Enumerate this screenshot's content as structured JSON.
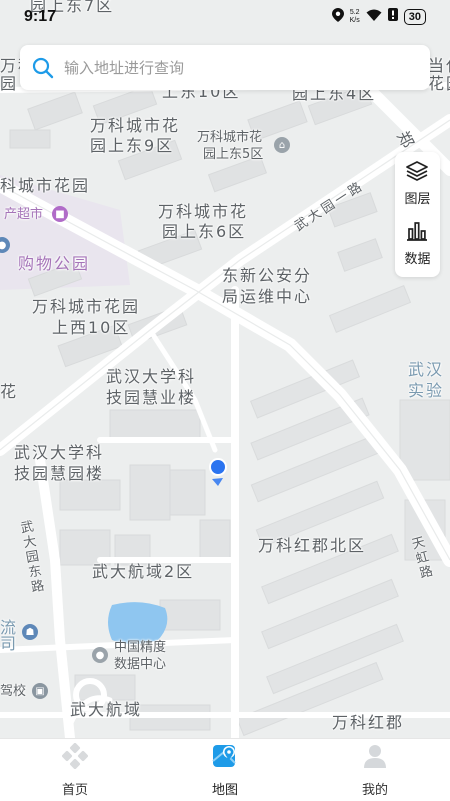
{
  "status_bar": {
    "time": "9:17",
    "net_speed_value": "5.2",
    "net_speed_unit": "K/s",
    "battery": "30"
  },
  "search": {
    "placeholder": "输入地址进行查询",
    "icon": "search-icon"
  },
  "side_panel": {
    "layers_label": "图层",
    "data_label": "数据"
  },
  "map": {
    "labels": {
      "top_cut": "园上东7区",
      "wanke_left_top": "万科",
      "wanke_left_top2": "园",
      "dangdai_right": "当代",
      "dangdai_right2": "花园",
      "shang10": "上东10区",
      "shangdong4": "园上东4区",
      "garden9_l1": "万科城市花",
      "garden9_l2": "园上东9区",
      "garden5_l1": "万科城市花",
      "garden5_l2": "园上东5区",
      "zheng_road": "郑",
      "wanke_garden_left": "科城市花园",
      "supermarket": "产超市",
      "garden6_l1": "万科城市花",
      "garden6_l2": "园上东6区",
      "wudayuan_road": "武大园一路",
      "shopping_park": "购物公园",
      "police_l1": "东新公安分",
      "police_l2": "局运维中心",
      "west10_l1": "万科城市花园",
      "west10_l2": "上西10区",
      "wuhan_lab_l1": "武汉",
      "wuhan_lab_l2": "实验",
      "huiye_l1": "武汉大学科",
      "huiye_l2": "技园慧业楼",
      "hua_left": "花",
      "huiyuan_l1": "武汉大学科",
      "huiyuan_l2": "技园慧园楼",
      "hongjun_north": "万科红郡北区",
      "wuda_yuandong_road": "武大园东路",
      "tianhong_road": "天虹路",
      "hangyu2": "武大航域2区",
      "liu": "流",
      "si": "司",
      "precision_l1": "中国精度",
      "precision_l2": "数据中心",
      "driving_school": "驾校",
      "hangyu": "武大航域",
      "hongjun": "万科红郡"
    },
    "user_location_color": "#2b74f0"
  },
  "bottom_nav": [
    {
      "label": "首页",
      "icon": "home-diamond-icon",
      "active": false
    },
    {
      "label": "地图",
      "icon": "map-pin-icon",
      "active": true
    },
    {
      "label": "我的",
      "icon": "user-profile-icon",
      "active": false
    }
  ],
  "colors": {
    "accent": "#1e9be8",
    "map_background": "#eceeee",
    "building": "#e0e2e3",
    "road": "#ffffff",
    "water": "#8fc6f0",
    "park_tint": "#e8e4ef"
  }
}
